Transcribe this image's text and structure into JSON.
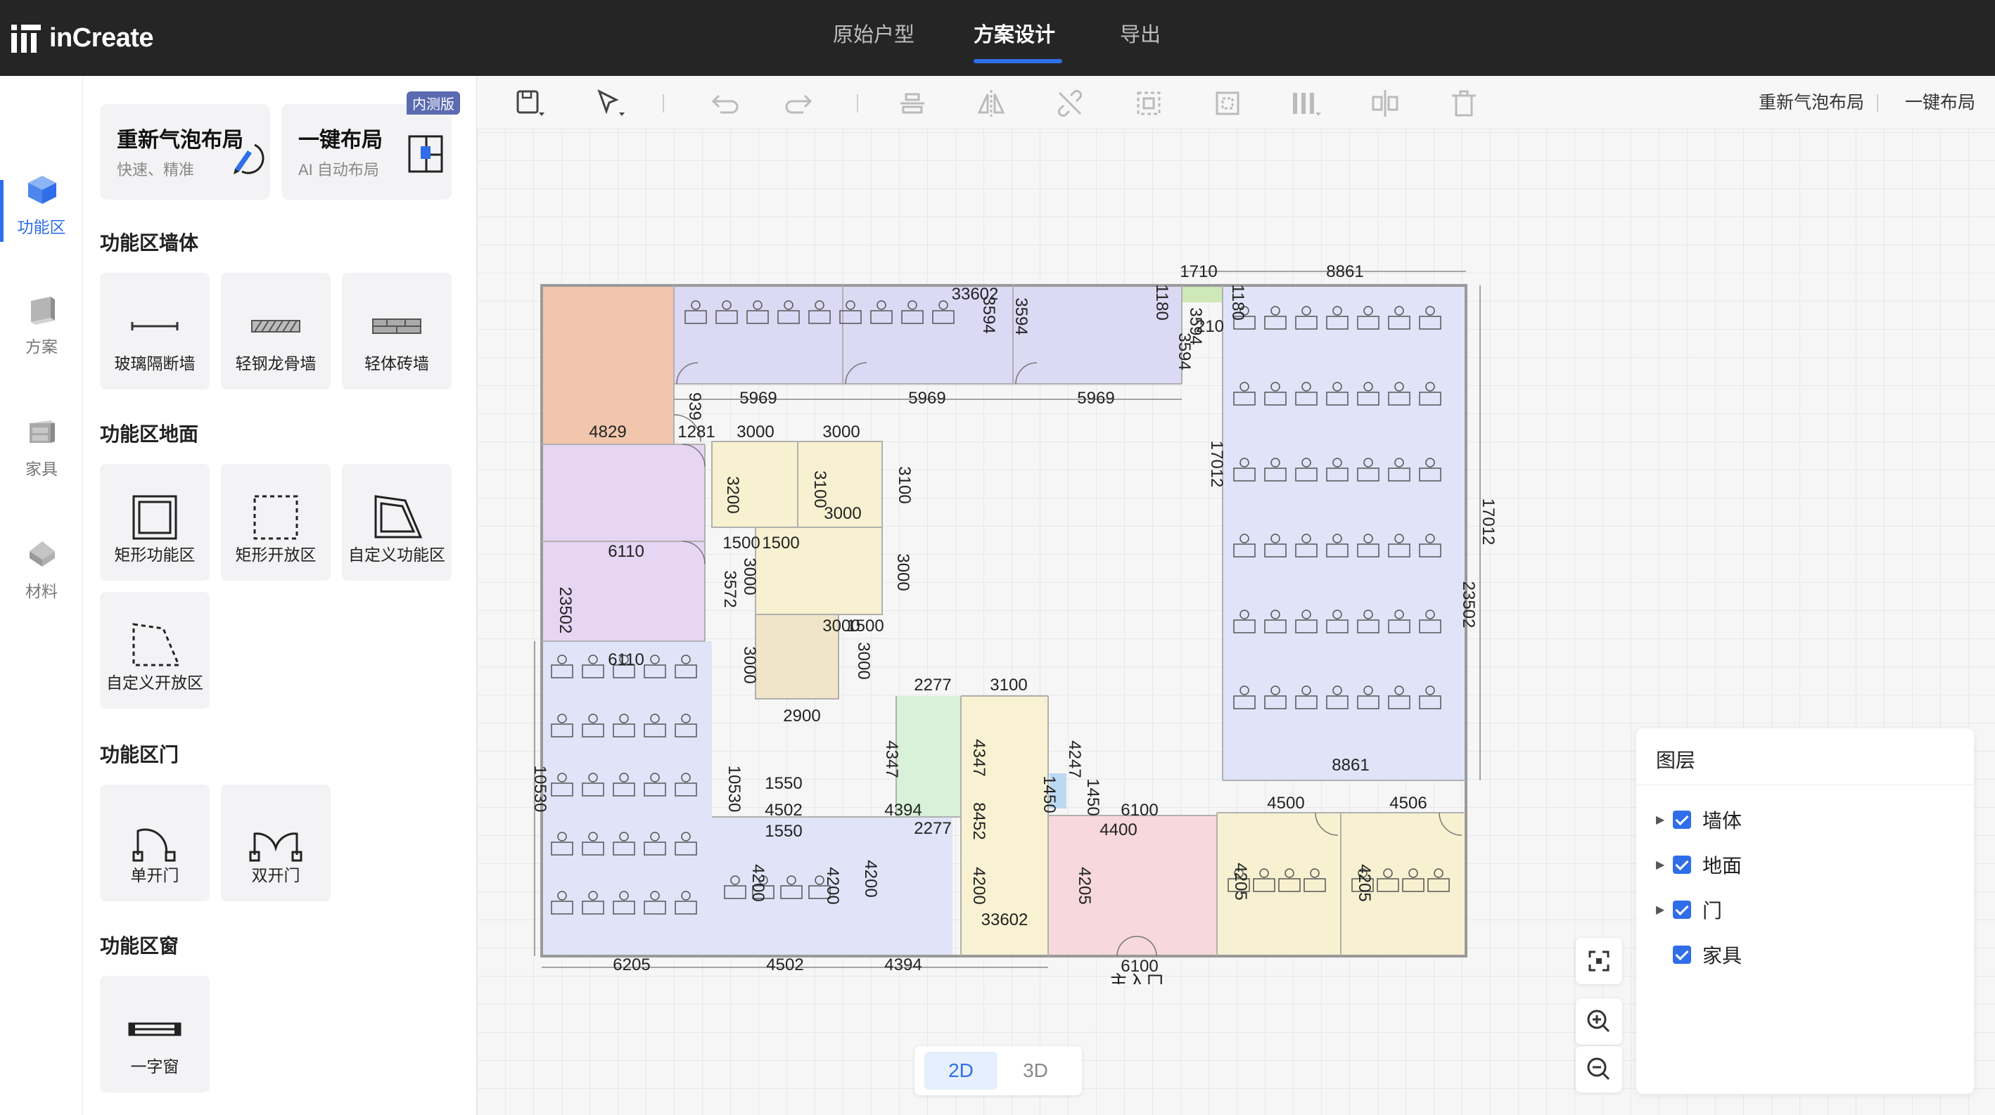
{
  "app": {
    "name": "inCreate"
  },
  "top_tabs": [
    {
      "label": "原始户型",
      "active": false
    },
    {
      "label": "方案设计",
      "active": true
    },
    {
      "label": "导出",
      "active": false
    }
  ],
  "rail": [
    {
      "label": "功能区",
      "icon": "cube-icon",
      "active": true
    },
    {
      "label": "方案",
      "icon": "book-icon",
      "active": false
    },
    {
      "label": "家具",
      "icon": "cabinet-icon",
      "active": false
    },
    {
      "label": "材料",
      "icon": "material-icon",
      "active": false
    }
  ],
  "panel": {
    "cards": [
      {
        "title": "重新气泡布局",
        "subtitle": "快速、精准",
        "icon": "pencil-icon"
      },
      {
        "title": "一键布局",
        "subtitle": "AI 自动布局",
        "icon": "layout-icon",
        "badge": "内测版"
      }
    ],
    "sections": [
      {
        "title": "功能区墙体",
        "items": [
          "玻璃隔断墙",
          "轻钢龙骨墙",
          "轻体砖墙"
        ]
      },
      {
        "title": "功能区地面",
        "items": [
          "矩形功能区",
          "矩形开放区",
          "自定义功能区",
          "自定义开放区"
        ]
      },
      {
        "title": "功能区门",
        "items": [
          "单开门",
          "双开门"
        ]
      },
      {
        "title": "功能区窗",
        "items": [
          "一字窗"
        ]
      }
    ]
  },
  "toolbar": {
    "rebubble": "重新气泡布局",
    "autolayout": "一键布局"
  },
  "plan": {
    "labels": [
      "1710",
      "8861",
      "1180",
      "3594",
      "5969",
      "5969",
      "5969",
      "33602",
      "3594",
      "3594",
      "1180",
      "3594",
      "210",
      "4829",
      "1281",
      "939",
      "3000",
      "3000",
      "3200",
      "3100",
      "3100",
      "3000",
      "1500",
      "1500",
      "3000",
      "3572",
      "3000",
      "6110",
      "6110",
      "23502",
      "3000",
      "1500",
      "3000",
      "3000",
      "2900",
      "2277",
      "3100",
      "4347",
      "4347",
      "4247",
      "1550",
      "4502",
      "1550",
      "10530",
      "10530",
      "4394",
      "2277",
      "8452",
      "1450",
      "1450",
      "6100",
      "4400",
      "4500",
      "4506",
      "4200",
      "4200",
      "4200",
      "4200",
      "4205",
      "4205",
      "4205",
      "17012",
      "17012",
      "23502",
      "8861",
      "33602",
      "6205",
      "4502",
      "4394",
      "6100"
    ],
    "entrance": "主入口"
  },
  "layers": {
    "title": "图层",
    "items": [
      {
        "label": "墙体",
        "expandable": true,
        "checked": true
      },
      {
        "label": "地面",
        "expandable": true,
        "checked": true
      },
      {
        "label": "门",
        "expandable": true,
        "checked": true
      },
      {
        "label": "家具",
        "expandable": false,
        "checked": true
      }
    ]
  },
  "view": {
    "options": [
      "2D",
      "3D"
    ],
    "active": "2D"
  },
  "colors": {
    "accent": "#2f6ee8",
    "topbar": "#252525"
  }
}
